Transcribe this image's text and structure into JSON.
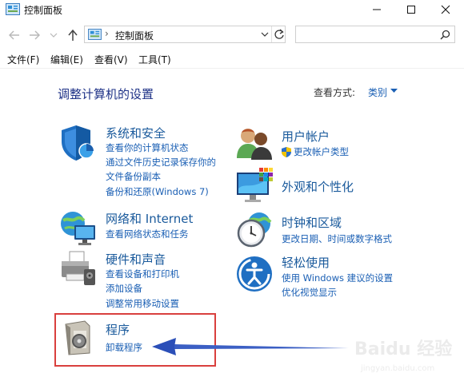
{
  "window": {
    "title": "控制面板"
  },
  "address": {
    "path": "控制面板",
    "separator": "›",
    "search_placeholder": ""
  },
  "menu": [
    "文件(F)",
    "编辑(E)",
    "查看(V)",
    "工具(T)"
  ],
  "main": {
    "heading": "调整计算机的设置",
    "view_by_label": "查看方式:",
    "view_by_value": "类别",
    "categories": [
      {
        "title": "系统和安全",
        "links": [
          "查看你的计算机状态",
          "通过文件历史记录保存你的",
          "文件备份副本",
          "备份和还原(Windows 7)"
        ]
      },
      {
        "title": "网络和 Internet",
        "links": [
          "查看网络状态和任务"
        ]
      },
      {
        "title": "硬件和声音",
        "links": [
          "查看设备和打印机",
          "添加设备",
          "调整常用移动设置"
        ]
      },
      {
        "title": "程序",
        "links": [
          "卸载程序"
        ]
      },
      {
        "title": "用户帐户",
        "links": [
          "更改帐户类型"
        ]
      },
      {
        "title": "外观和个性化",
        "links": []
      },
      {
        "title": "时钟和区域",
        "links": [
          "更改日期、时间或数字格式"
        ]
      },
      {
        "title": "轻松使用",
        "links": [
          "使用 Windows 建议的设置",
          "优化视觉显示"
        ]
      }
    ]
  },
  "watermark": {
    "brand": "Baidu 经验",
    "url": "jingyan.baidu.com"
  },
  "colors": {
    "link": "#1a5fb4",
    "heading": "#1e3287",
    "highlight_box": "#d9403e",
    "arrow": "#3b5fc4"
  },
  "icons": [
    "control-panel-icon",
    "minimize-icon",
    "maximize-icon",
    "close-icon",
    "back-icon",
    "forward-icon",
    "up-icon",
    "refresh-icon",
    "search-icon",
    "shield-icon",
    "network-icon",
    "printer-icon",
    "program-icon",
    "users-icon",
    "appearance-icon",
    "clock-icon",
    "ease-of-access-icon"
  ]
}
